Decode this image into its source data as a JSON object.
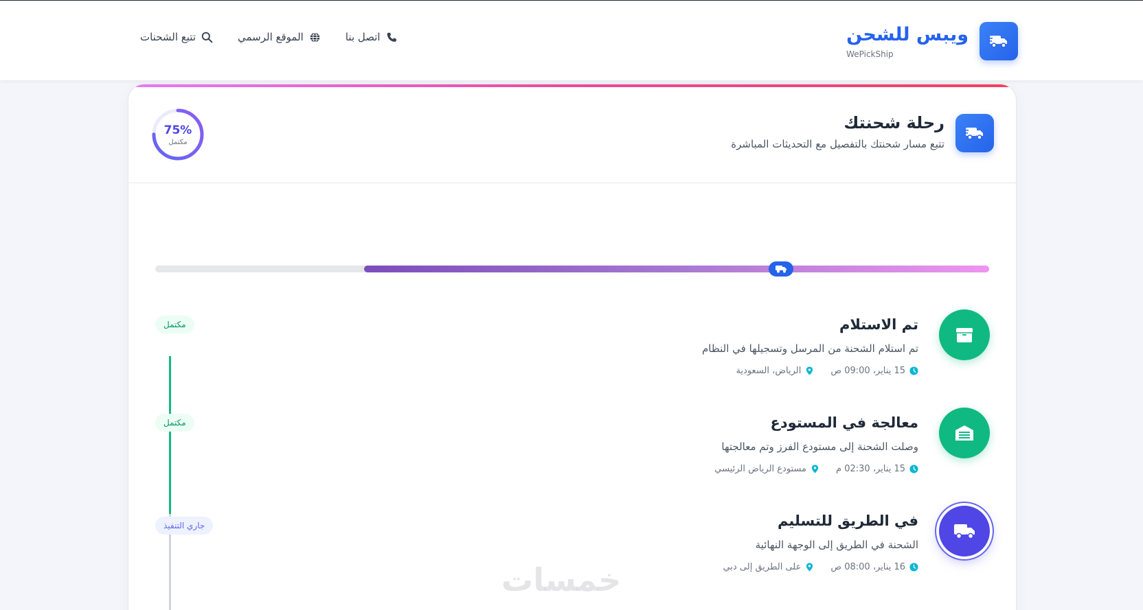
{
  "header": {
    "brand_name": "ويبس للشحن",
    "brand_sub": "WePickShip",
    "nav": [
      {
        "label": "تتبع الشحنات",
        "icon": "search-icon"
      },
      {
        "label": "الموقع الرسمي",
        "icon": "globe-icon"
      },
      {
        "label": "اتصل بنا",
        "icon": "phone-icon"
      }
    ]
  },
  "journey": {
    "title": "رحلة شحنتك",
    "subtitle": "تتبع مسار شحنتك بالتفصيل مع التحديثات المباشرة",
    "progress_percent": 75,
    "progress_text": "75%",
    "progress_label": "مكتمل",
    "track_fill_fraction": 0.75
  },
  "steps": [
    {
      "title": "تم الاستلام",
      "description": "تم استلام الشحنة من المرسل وتسجيلها في النظام",
      "time": "15 يناير، 09:00 ص",
      "location": "الرياض، السعودية",
      "status": "مكتمل",
      "icon": "box-icon"
    },
    {
      "title": "معالجة في المستودع",
      "description": "وصلت الشحنة إلى مستودع الفرز وتم معالجتها",
      "time": "15 يناير، 02:30 م",
      "location": "مستودع الرياض الرئيسي",
      "status": "مكتمل",
      "icon": "warehouse-icon"
    },
    {
      "title": "في الطريق للتسليم",
      "description": "الشحنة في الطريق إلى الوجهة النهائية",
      "time": "16 يناير، 08:00 ص",
      "location": "على الطريق إلى دبي",
      "status": "جاري التنفيذ",
      "icon": "truck-icon"
    }
  ],
  "watermark": "خمسات",
  "colors": {
    "primary": "#2563eb",
    "success": "#10b981",
    "active": "#4f46e5",
    "accent": "#a778d1"
  }
}
